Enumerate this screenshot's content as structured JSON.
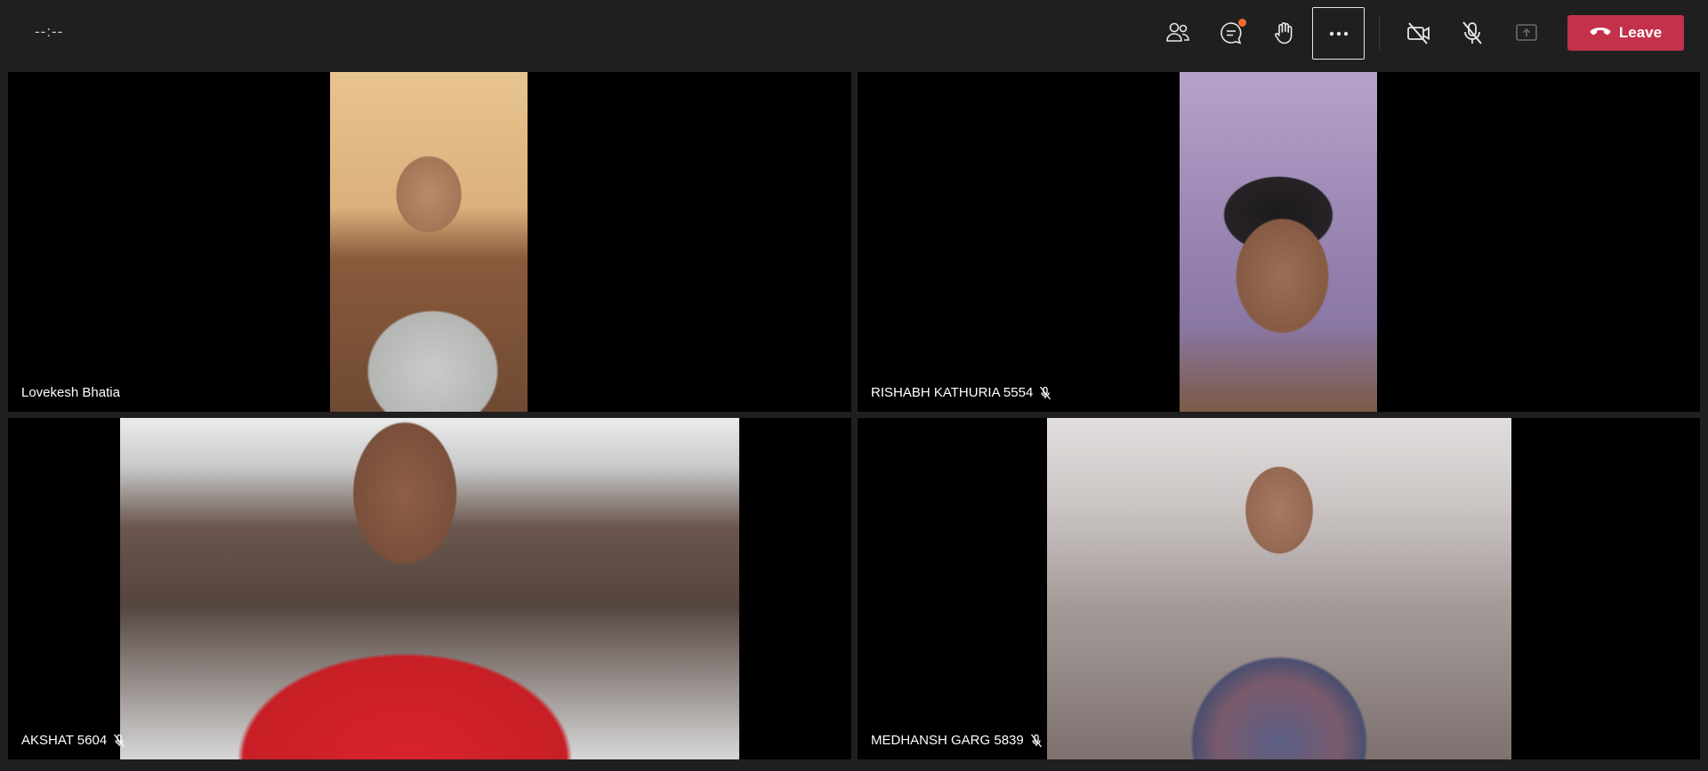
{
  "window": {
    "timer": "--:--"
  },
  "toolbar": {
    "buttons": [
      {
        "name": "participants",
        "icon": "people-icon"
      },
      {
        "name": "chat",
        "icon": "chat-icon"
      },
      {
        "name": "raise-hand",
        "icon": "raise-hand-icon"
      },
      {
        "name": "more-actions",
        "icon": "more-icon"
      },
      {
        "name": "camera-off",
        "icon": "camera-off-icon"
      },
      {
        "name": "mic-off",
        "icon": "mic-off-icon"
      },
      {
        "name": "share",
        "icon": "share-icon"
      }
    ],
    "leave_label": "Leave"
  },
  "colors": {
    "background": "#1f1f1f",
    "tile": "#000000",
    "leave": "#c4314b",
    "badge": "#f06b2b"
  },
  "participants": [
    {
      "name": "Lovekesh Bhatia",
      "muted": false,
      "video_palette": "warm"
    },
    {
      "name": "RISHABH KATHURIA 5554",
      "muted": true,
      "video_palette": "lavender"
    },
    {
      "name": "AKSHAT 5604",
      "muted": true,
      "video_palette": "red"
    },
    {
      "name": "MEDHANSH GARG 5839",
      "muted": true,
      "video_palette": "neutral"
    }
  ]
}
